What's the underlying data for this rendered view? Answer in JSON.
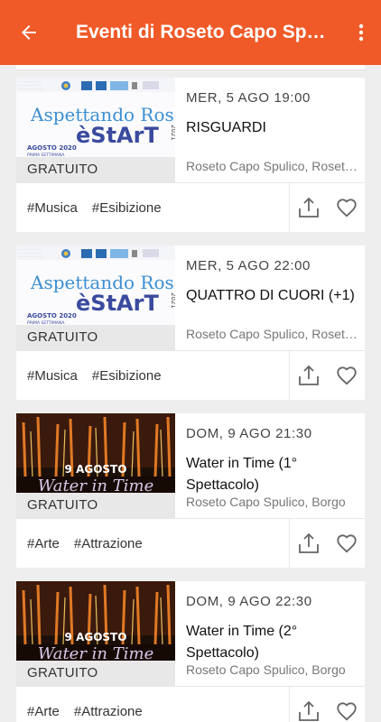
{
  "app_bar": {
    "title": "Eventi di Roseto Capo Spulico",
    "back_icon": "arrow-back-icon",
    "menu_icon": "more-vertical-icon",
    "color": "#f05a28"
  },
  "events": [
    {
      "date": "MER, 5 AGO 19:00",
      "title": "RISGUARDI",
      "location": "Roseto Capo Spulico, Roseto Capo Spulico",
      "price": "GRATUITO",
      "tags": [
        "#Musica",
        "#Esibizione"
      ],
      "poster": {
        "line1": "Aspettando Roseto",
        "line2": "èStArT",
        "line3": "AGOSTO 2020",
        "line4": "PRIMA SETTIMANA",
        "year": "2021"
      }
    },
    {
      "date": "MER, 5 AGO 22:00",
      "title": "QUATTRO DI CUORI (+1)",
      "location": "Roseto Capo Spulico, Roseto Capo Spulico",
      "price": "GRATUITO",
      "tags": [
        "#Musica",
        "#Esibizione"
      ],
      "poster": {
        "line1": "Aspettando Roseto",
        "line2": "èStArT",
        "line3": "AGOSTO 2020",
        "line4": "PRIMA SETTIMANA",
        "year": "2021"
      }
    },
    {
      "date": "DOM, 9 AGO 21:30",
      "title": "Water in Time (1° Spettacolo)",
      "location": "Roseto Capo Spulico, Borgo",
      "price": "GRATUITO",
      "tags": [
        "#Arte",
        "#Attrazione"
      ],
      "poster": {
        "line1": "9 AGOSTO",
        "line2": "Water in Time"
      }
    },
    {
      "date": "DOM, 9 AGO 22:30",
      "title": "Water in Time (2° Spettacolo)",
      "location": "Roseto Capo Spulico, Borgo",
      "price": "GRATUITO",
      "tags": [
        "#Arte",
        "#Attrazione"
      ],
      "poster": {
        "line1": "9 AGOSTO",
        "line2": "Water in Time"
      }
    }
  ]
}
